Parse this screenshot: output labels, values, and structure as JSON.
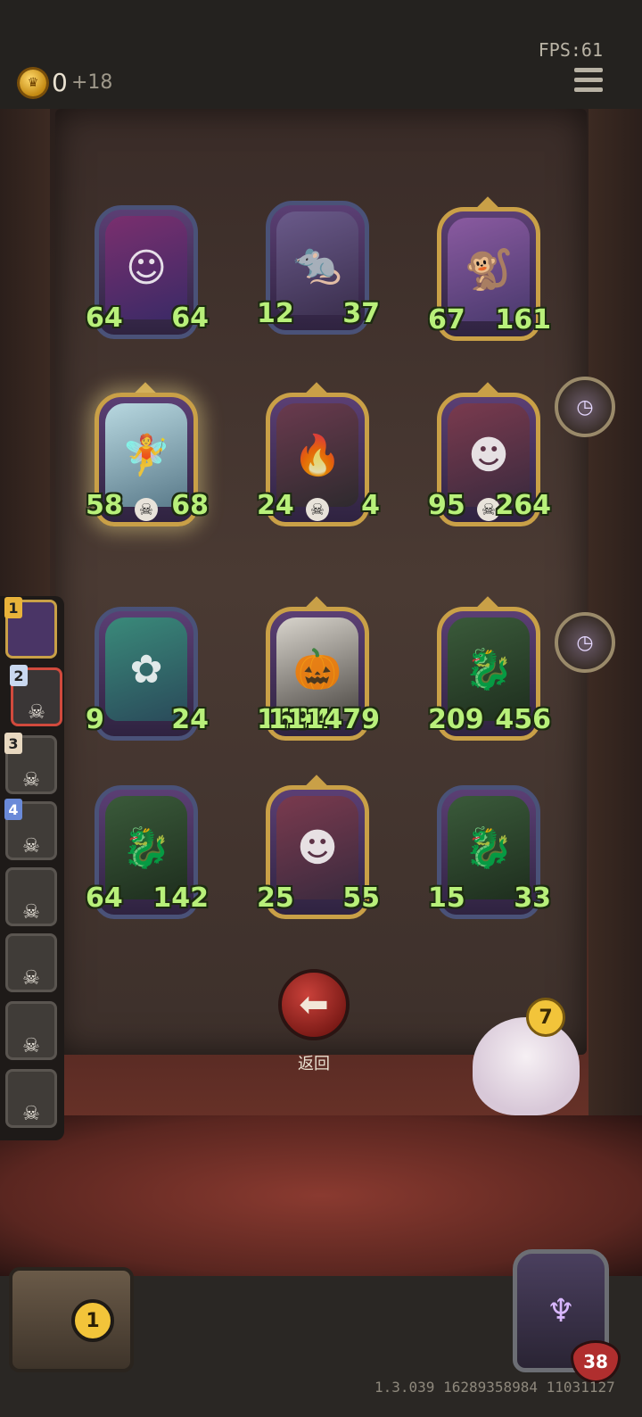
{
  "hud": {
    "coins": "0",
    "coin_income": "+18",
    "fps": "FPS:61"
  },
  "board": [
    {
      "id": "c1",
      "attack": "64",
      "health": "64",
      "gold": false,
      "skull": false,
      "portrait": "clown"
    },
    {
      "id": "c2",
      "attack": "12",
      "health": "37",
      "gold": false,
      "skull": false,
      "portrait": "rat"
    },
    {
      "id": "c3",
      "attack": "67",
      "health": "161",
      "gold": true,
      "skull": false,
      "portrait": "monkey"
    },
    {
      "id": "c4",
      "attack": "58",
      "health": "68",
      "gold": true,
      "skull": true,
      "portrait": "fairy"
    },
    {
      "id": "c5",
      "attack": "24",
      "health": "4",
      "gold": true,
      "skull": true,
      "portrait": "fire-bull"
    },
    {
      "id": "c6",
      "attack": "95",
      "health": "264",
      "gold": true,
      "skull": true,
      "portrait": "red-hair"
    },
    {
      "id": "c7",
      "attack": "9",
      "health": "24",
      "gold": false,
      "skull": false,
      "portrait": "gorgon"
    },
    {
      "id": "c8",
      "attack": "1694",
      "health": "111479",
      "gold": true,
      "skull": false,
      "portrait": "pumpkin"
    },
    {
      "id": "c9",
      "attack": "209",
      "health": "456",
      "gold": true,
      "skull": false,
      "portrait": "dragon"
    },
    {
      "id": "c10",
      "attack": "64",
      "health": "142",
      "gold": false,
      "skull": false,
      "portrait": "dragon"
    },
    {
      "id": "c11",
      "attack": "25",
      "health": "55",
      "gold": true,
      "skull": false,
      "portrait": "red-hair"
    },
    {
      "id": "c12",
      "attack": "15",
      "health": "33",
      "gold": false,
      "skull": false,
      "portrait": "dragon"
    }
  ],
  "sidebar_slots": [
    {
      "num": "1",
      "state": "active"
    },
    {
      "num": "2",
      "state": "selected"
    },
    {
      "num": "3",
      "state": "dead"
    },
    {
      "num": "4",
      "state": "dead"
    },
    {
      "num": "",
      "state": "dead"
    },
    {
      "num": "",
      "state": "dead"
    },
    {
      "num": "",
      "state": "dead"
    },
    {
      "num": "",
      "state": "dead"
    }
  ],
  "back_button": {
    "label": "返回"
  },
  "mascot": {
    "badge": "7"
  },
  "chest": {
    "count": "1"
  },
  "hero": {
    "hp": "38"
  },
  "version": "1.3.039 16289358984 11031127"
}
